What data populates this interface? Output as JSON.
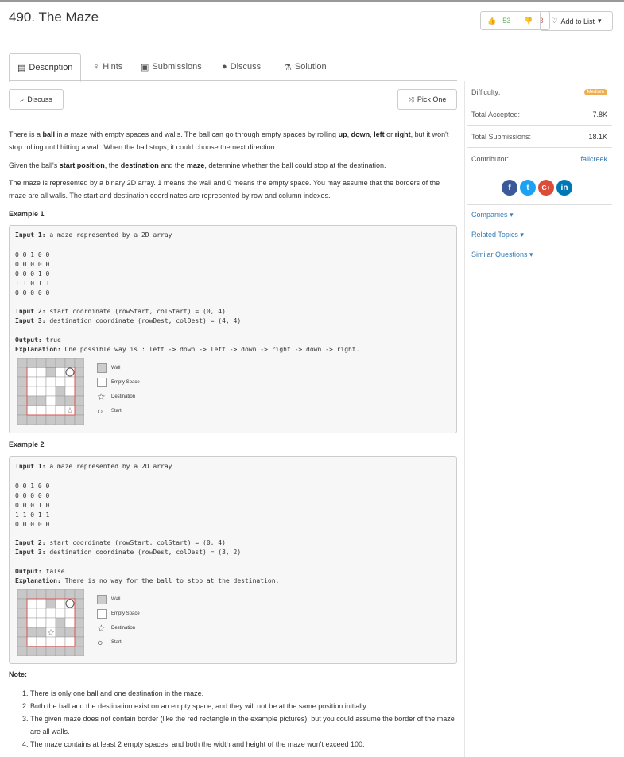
{
  "header": {
    "title": "490. The Maze",
    "upvotes": "53",
    "downvotes": "3",
    "add_to_list": "Add to List"
  },
  "tabs": [
    {
      "label": "Description",
      "icon": "list-icon"
    },
    {
      "label": "Hints",
      "icon": "bulb-icon"
    },
    {
      "label": "Submissions",
      "icon": "doc-icon"
    },
    {
      "label": "Discuss",
      "icon": "chat-icon"
    },
    {
      "label": "Solution",
      "icon": "flask-icon"
    }
  ],
  "buttons": {
    "discuss": "Discuss",
    "pick_one": "Pick One"
  },
  "description": {
    "p1_a": "There is a ",
    "p1_ball": "ball",
    "p1_b": " in a maze with empty spaces and walls. The ball can go through empty spaces by rolling ",
    "p1_up": "up",
    "p1_c": ", ",
    "p1_down": "down",
    "p1_d": ", ",
    "p1_left": "left",
    "p1_e": " or ",
    "p1_right": "right",
    "p1_f": ", but it won't stop rolling until hitting a wall. When the ball stops, it could choose the next direction.",
    "p2_a": "Given the ball's ",
    "p2_start": "start position",
    "p2_b": ", the ",
    "p2_dest": "destination",
    "p2_c": " and the ",
    "p2_maze": "maze",
    "p2_d": ", determine whether the ball could stop at the destination.",
    "p3": "The maze is represented by a binary 2D array. 1 means the wall and 0 means the empty space. You may assume that the borders of the maze are all walls. The start and destination coordinates are represented by row and column indexes."
  },
  "examples": [
    {
      "title": "Example 1",
      "input1_label": "Input 1:",
      "input1": " a maze represented by a 2D array",
      "grid": [
        "0 0 1 0 0",
        "0 0 0 0 0",
        "0 0 0 1 0",
        "1 1 0 1 1",
        "0 0 0 0 0"
      ],
      "input2_label": "Input 2:",
      "input2": " start coordinate (rowStart, colStart) = (0, 4)",
      "input3_label": "Input 3:",
      "input3": " destination coordinate (rowDest, colDest) = (4, 4)",
      "output_label": "Output:",
      "output": " true",
      "expl_label": "Explanation:",
      "expl": " One possible way is : left -> down -> left -> down -> right -> down -> right."
    },
    {
      "title": "Example 2",
      "input1_label": "Input 1:",
      "input1": " a maze represented by a 2D array",
      "grid": [
        "0 0 1 0 0",
        "0 0 0 0 0",
        "0 0 0 1 0",
        "1 1 0 1 1",
        "0 0 0 0 0"
      ],
      "input2_label": "Input 2:",
      "input2": " start coordinate (rowStart, colStart) = (0, 4)",
      "input3_label": "Input 3:",
      "input3": " destination coordinate (rowDest, colDest) = (3, 2)",
      "output_label": "Output:",
      "output": " false",
      "expl_label": "Explanation:",
      "expl": " There is no way for the ball to stop at the destination."
    }
  ],
  "legend": {
    "wall": "Wall",
    "empty": "Empty Space",
    "destination": "Destination",
    "start": "Start"
  },
  "note": {
    "title": "Note:",
    "items": [
      "There is only one ball and one destination in the maze.",
      "Both the ball and the destination exist on an empty space, and they will not be at the same position initially.",
      "The given maze does not contain border (like the red rectangle in the example pictures), but you could assume the border of the maze are all walls.",
      "The maze contains at least 2 empty spaces, and both the width and height of the maze won't exceed 100."
    ]
  },
  "sidebar": {
    "difficulty_label": "Difficulty:",
    "difficulty": "Medium",
    "accepted_label": "Total Accepted:",
    "accepted": "7.8K",
    "submissions_label": "Total Submissions:",
    "submissions": "18.1K",
    "contributor_label": "Contributor:",
    "contributor": "fallcreek",
    "companies": "Companies",
    "related": "Related Topics",
    "similar": "Similar Questions",
    "colors": {
      "facebook": "#3b5998",
      "twitter": "#1da1f2",
      "google": "#dd4b39",
      "linkedin": "#0077b5"
    }
  }
}
